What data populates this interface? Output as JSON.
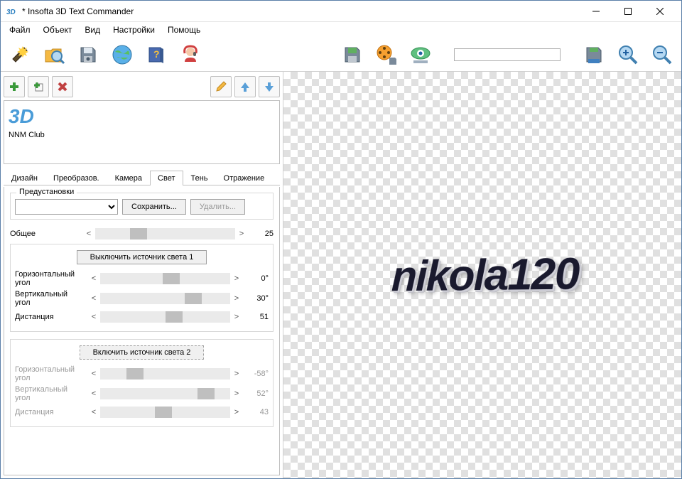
{
  "window": {
    "title": "* Insofta 3D Text Commander"
  },
  "menu": {
    "file": "Файл",
    "object": "Объект",
    "view": "Вид",
    "settings": "Настройки",
    "help": "Помощь"
  },
  "layer": {
    "preview_text": "3D",
    "preview_label": "NNM Club"
  },
  "tabs": {
    "design": "Дизайн",
    "transform": "Преобразов.",
    "camera": "Камера",
    "light": "Свет",
    "shadow": "Тень",
    "reflection": "Отражение"
  },
  "presets": {
    "title": "Предустановки",
    "save": "Сохранить...",
    "delete": "Удалить..."
  },
  "common": {
    "label": "Общее",
    "value": "25"
  },
  "light1": {
    "toggle": "Выключить источник света 1",
    "h_angle_label": "Горизонтальный угол",
    "h_angle_value": "0°",
    "v_angle_label": "Вертикальный угол",
    "v_angle_value": "30°",
    "distance_label": "Дистанция",
    "distance_value": "51"
  },
  "light2": {
    "toggle": "Включить источник света 2",
    "h_angle_label": "Горизонтальный угол",
    "h_angle_value": "-58°",
    "v_angle_label": "Вертикальный угол",
    "v_angle_value": "52°",
    "distance_label": "Дистанция",
    "distance_value": "43"
  },
  "canvas": {
    "text": "nikola120"
  }
}
